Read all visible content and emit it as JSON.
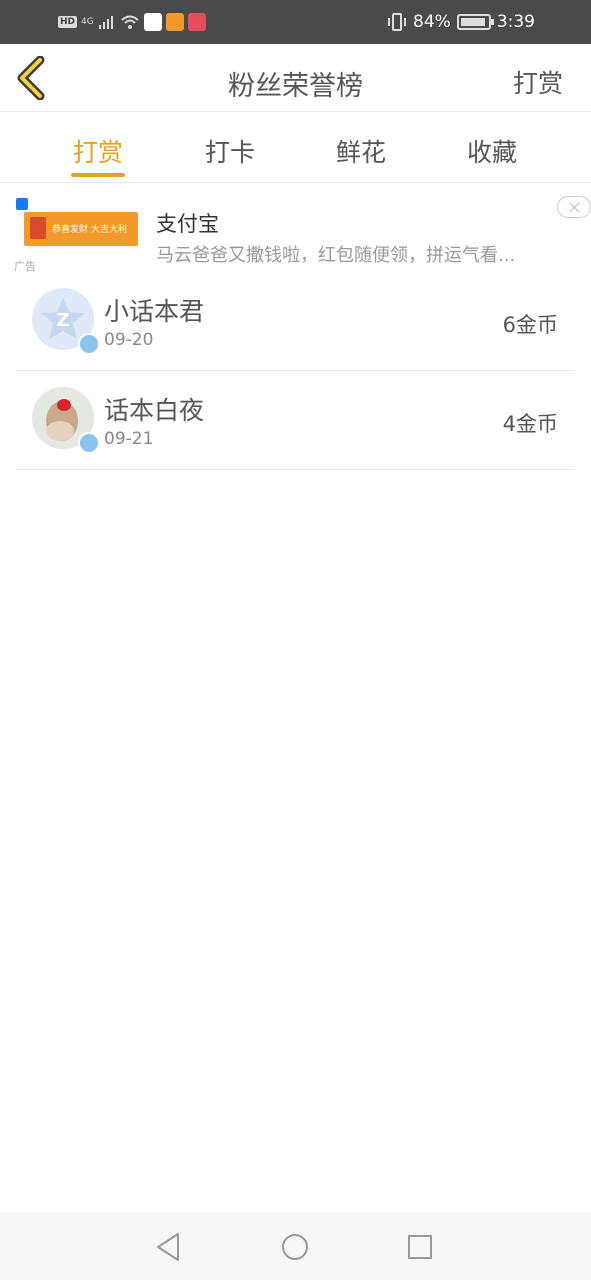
{
  "status_bar": {
    "hd": "HD",
    "network": "4G",
    "battery": "84%",
    "time": "3:39"
  },
  "header": {
    "title": "粉丝荣誉榜",
    "action": "打赏"
  },
  "tabs": [
    {
      "label": "打赏",
      "active": true
    },
    {
      "label": "打卡",
      "active": false
    },
    {
      "label": "鲜花",
      "active": false
    },
    {
      "label": "收藏",
      "active": false
    }
  ],
  "ad": {
    "title": "支付宝",
    "description": "马云爸爸又撒钱啦，红包随便领，拼运气看...",
    "tag": "广告",
    "banner_text": "恭喜发财 大吉大利"
  },
  "fans": [
    {
      "name": "小话本君",
      "date": "09-20",
      "amount": "6金币"
    },
    {
      "name": "话本白夜",
      "date": "09-21",
      "amount": "4金币"
    }
  ],
  "colors": {
    "accent": "#e8a11d",
    "status_bar": "#4a4a4a"
  }
}
